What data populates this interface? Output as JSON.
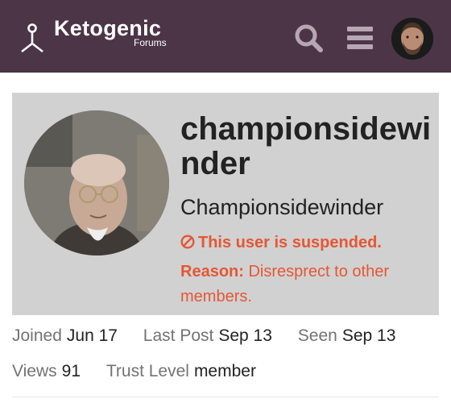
{
  "header": {
    "logo_title": "Ketogenic",
    "logo_subtitle": "Forums",
    "background": "#4b3547",
    "icons": [
      "search-icon",
      "hamburger-menu-icon"
    ]
  },
  "profile": {
    "username": "championsidewinder",
    "full_name": "Championsidewinder",
    "suspended_message": "This user is suspended.",
    "reason_label": "Reason:",
    "reason_text": "Disresprect to other members.",
    "alert_color": "#e45735",
    "card_background": "#d1d1d1"
  },
  "stats": {
    "joined_label": "Joined",
    "joined_value": "Jun 17",
    "last_post_label": "Last Post",
    "last_post_value": "Sep 13",
    "seen_label": "Seen",
    "seen_value": "Sep 13",
    "views_label": "Views",
    "views_value": "91",
    "trust_label": "Trust Level",
    "trust_value": "member"
  }
}
